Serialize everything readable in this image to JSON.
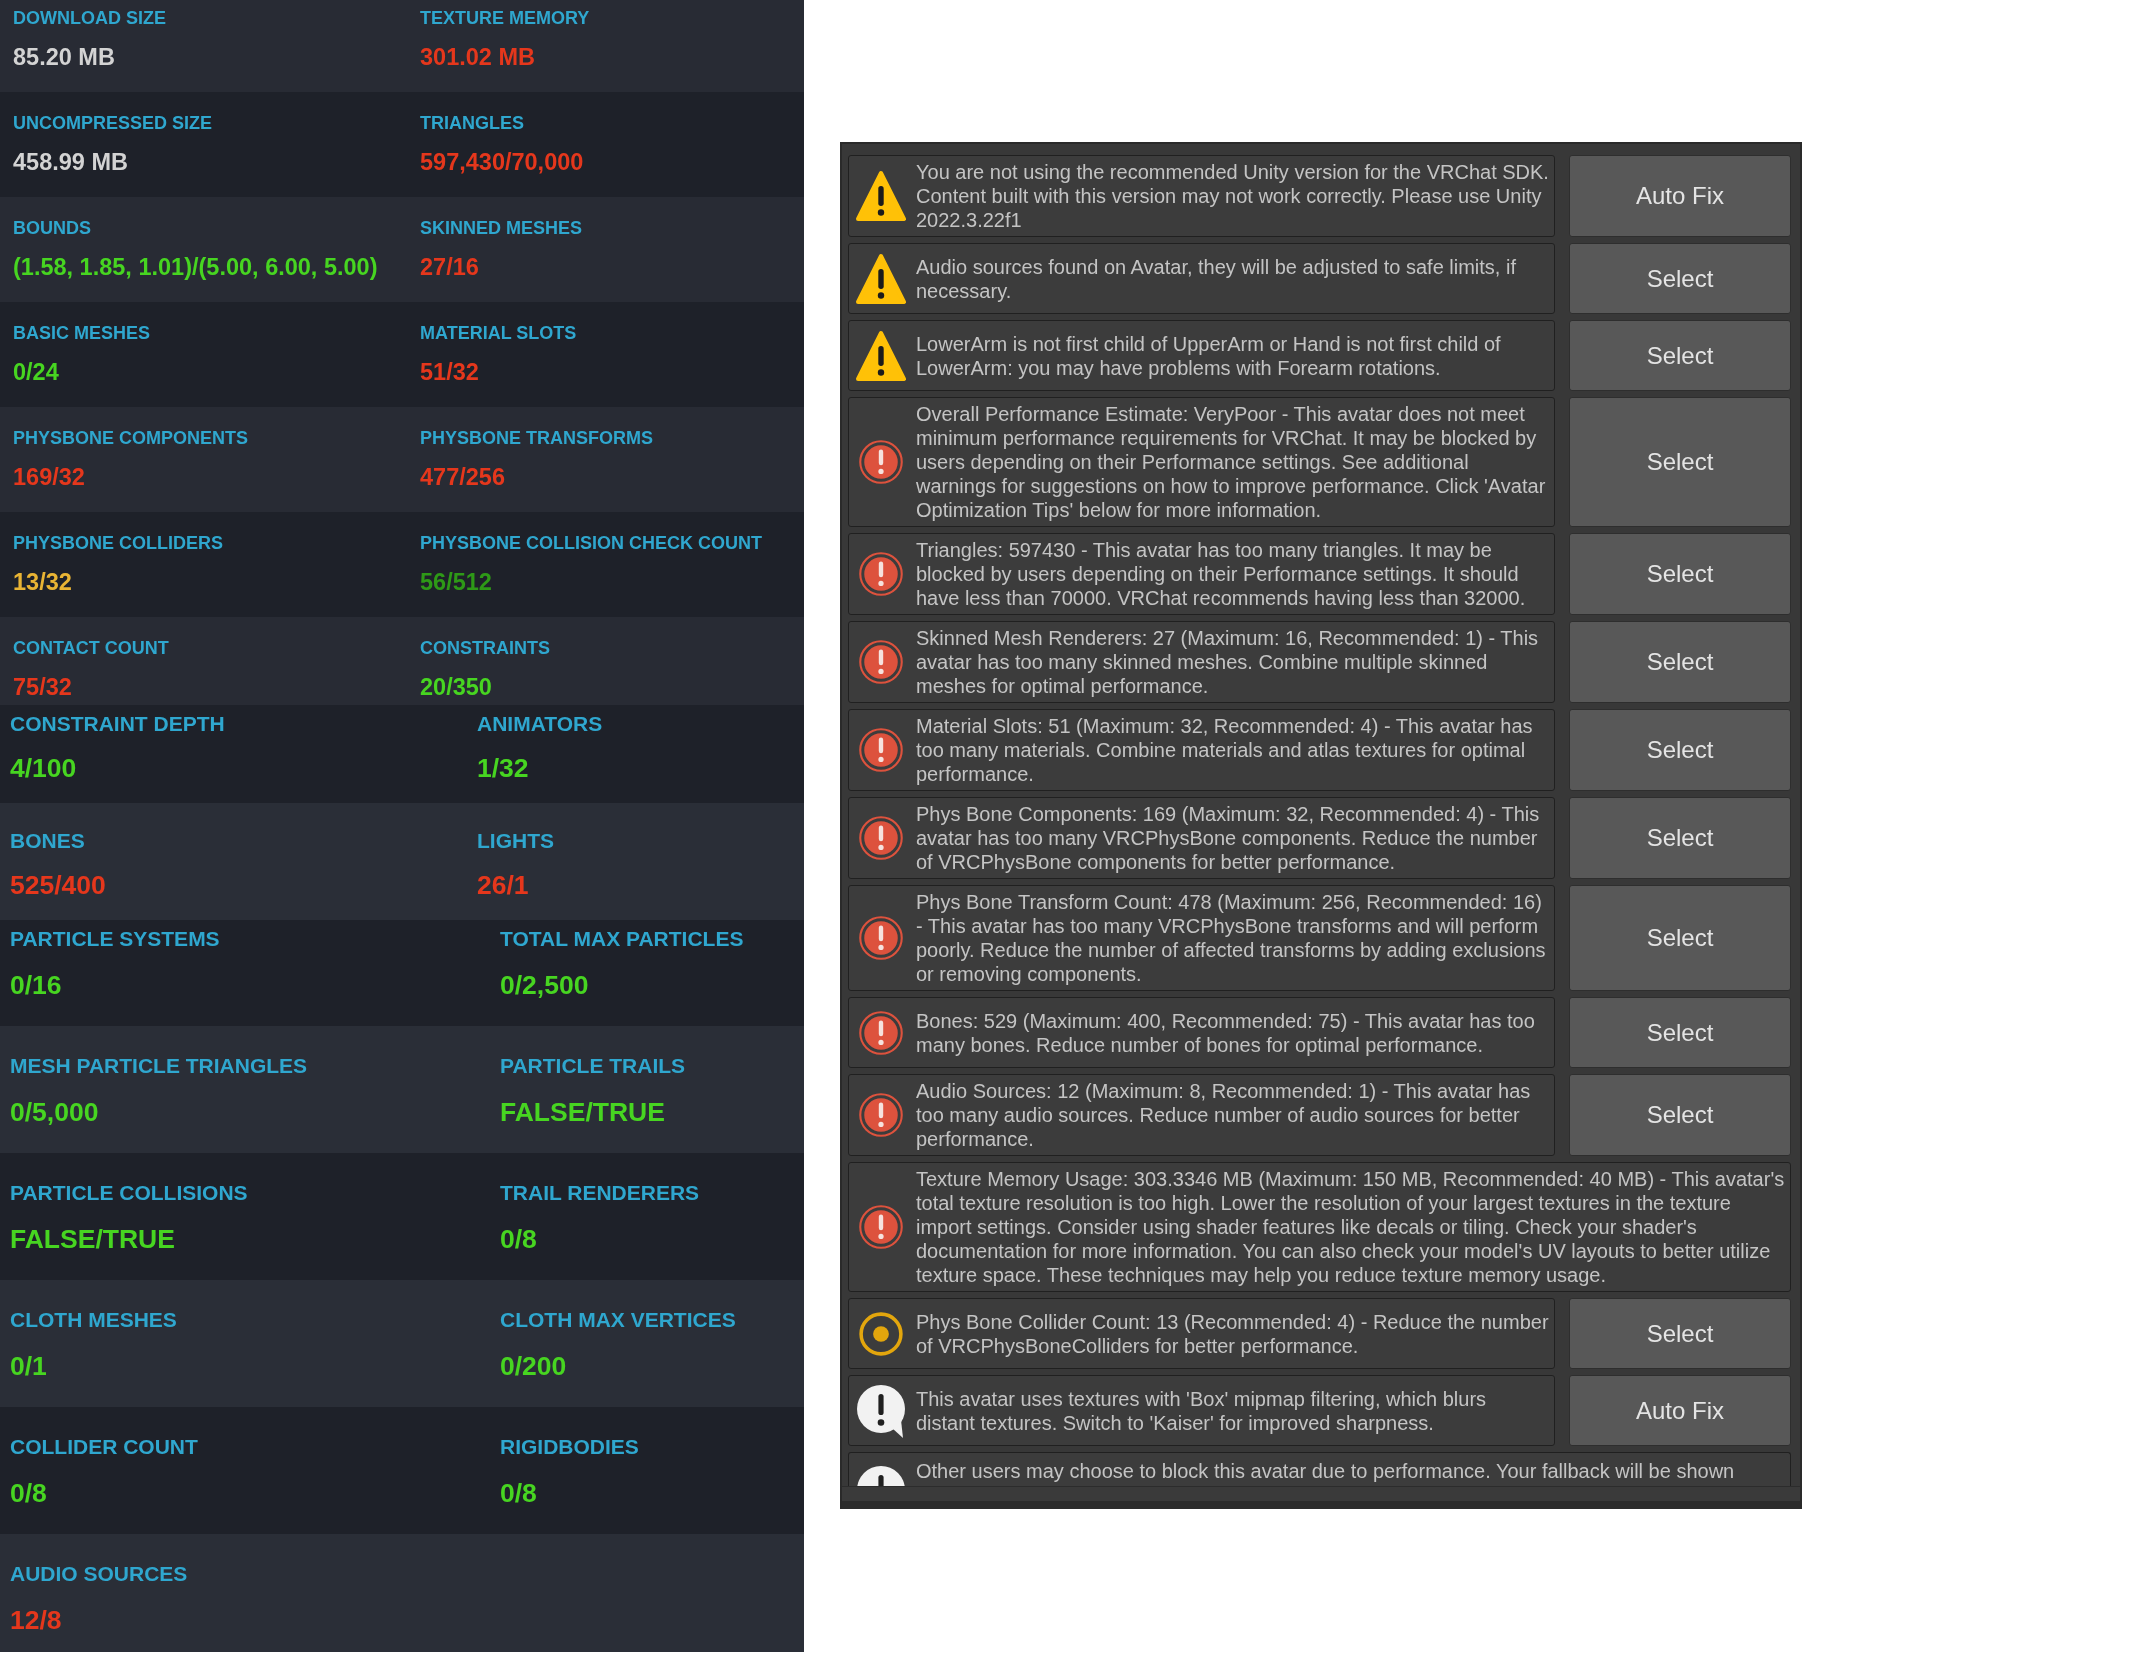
{
  "stats_panels": [
    {
      "rows": [
        {
          "stats": [
            {
              "label": "DOWNLOAD SIZE",
              "value": "85.20 MB",
              "color": "#d3d3d3"
            },
            {
              "label": "TEXTURE MEMORY",
              "value": "301.02 MB",
              "color": "#e5371c"
            }
          ]
        },
        {
          "stats": [
            {
              "label": "UNCOMPRESSED SIZE",
              "value": "458.99 MB",
              "color": "#d3d3d3"
            },
            {
              "label": "TRIANGLES",
              "value": "597,430/70,000",
              "color": "#e5371c"
            }
          ]
        },
        {
          "stats": [
            {
              "label": "BOUNDS",
              "value": "(1.58, 1.85, 1.01)/(5.00, 6.00, 5.00)",
              "color": "#47d521"
            },
            {
              "label": "SKINNED MESHES",
              "value": "27/16",
              "color": "#e5371c"
            }
          ]
        },
        {
          "stats": [
            {
              "label": "BASIC MESHES",
              "value": "0/24",
              "color": "#47d521"
            },
            {
              "label": "MATERIAL SLOTS",
              "value": "51/32",
              "color": "#e5371c"
            }
          ]
        },
        {
          "stats": [
            {
              "label": "PHYSBONE COMPONENTS",
              "value": "169/32",
              "color": "#e5371c"
            },
            {
              "label": "PHYSBONE TRANSFORMS",
              "value": "477/256",
              "color": "#e5371c"
            }
          ]
        },
        {
          "stats": [
            {
              "label": "PHYSBONE COLLIDERS",
              "value": "13/32",
              "color": "#e9b434"
            },
            {
              "label": "PHYSBONE COLLISION CHECK COUNT",
              "value": "56/512",
              "color": "#2e9917"
            }
          ]
        },
        {
          "stats": [
            {
              "label": "CONTACT COUNT",
              "value": "75/32",
              "color": "#e5371c"
            },
            {
              "label": "CONSTRAINTS",
              "value": "20/350",
              "color": "#47d521"
            }
          ]
        }
      ]
    },
    {
      "rows": [
        {
          "stats": [
            {
              "label": "CONSTRAINT DEPTH",
              "value": "4/100",
              "color": "#47d521"
            },
            {
              "label": "ANIMATORS",
              "value": "1/32",
              "color": "#47d521"
            }
          ]
        },
        {
          "stats": [
            {
              "label": "BONES",
              "value": "525/400",
              "color": "#e5371c"
            },
            {
              "label": "LIGHTS",
              "value": "26/1",
              "color": "#e5371c"
            }
          ]
        }
      ]
    },
    {
      "rows": [
        {
          "stats": [
            {
              "label": "PARTICLE SYSTEMS",
              "value": "0/16",
              "color": "#47d521"
            },
            {
              "label": "TOTAL MAX PARTICLES",
              "value": "0/2,500",
              "color": "#47d521"
            }
          ]
        },
        {
          "stats": [
            {
              "label": "MESH PARTICLE TRIANGLES",
              "value": "0/5,000",
              "color": "#47d521"
            },
            {
              "label": "PARTICLE TRAILS",
              "value": "FALSE/TRUE",
              "color": "#47d521"
            }
          ]
        },
        {
          "stats": [
            {
              "label": "PARTICLE COLLISIONS",
              "value": "FALSE/TRUE",
              "color": "#47d521"
            },
            {
              "label": "TRAIL RENDERERS",
              "value": "0/8",
              "color": "#47d521"
            }
          ]
        },
        {
          "stats": [
            {
              "label": "CLOTH MESHES",
              "value": "0/1",
              "color": "#47d521"
            },
            {
              "label": "CLOTH MAX VERTICES",
              "value": "0/200",
              "color": "#47d521"
            }
          ]
        },
        {
          "stats": [
            {
              "label": "COLLIDER COUNT",
              "value": "0/8",
              "color": "#47d521"
            },
            {
              "label": "RIGIDBODIES",
              "value": "0/8",
              "color": "#47d521"
            }
          ]
        },
        {
          "stats": [
            {
              "label": "AUDIO SOURCES",
              "value": "12/8",
              "color": "#e5371c"
            }
          ]
        }
      ]
    }
  ],
  "validation_messages": [
    {
      "kind": "warning",
      "text": "You are not using the recommended Unity version for the VRChat SDK. Content built with this version may not work correctly. Please use Unity 2022.3.22f1",
      "button": "Auto Fix"
    },
    {
      "kind": "warning",
      "text": "Audio sources found on Avatar, they will be adjusted to safe limits, if necessary.",
      "button": "Select"
    },
    {
      "kind": "warning",
      "text": "LowerArm is not first child of UpperArm or Hand is not first child of LowerArm: you may have problems with Forearm rotations.",
      "button": "Select"
    },
    {
      "kind": "error",
      "text": "Overall Performance Estimate: VeryPoor - This avatar does not meet minimum performance requirements for VRChat. It may be blocked by users depending on their Performance settings. See additional warnings for suggestions on how to improve performance. Click 'Avatar Optimization Tips' below for more information.",
      "button": "Select"
    },
    {
      "kind": "error",
      "text": "Triangles: 597430 - This avatar has too many triangles. It may be blocked by users depending on their Performance settings. It should have less than 70000. VRChat recommends having less than 32000.",
      "button": "Select"
    },
    {
      "kind": "error",
      "text": "Skinned Mesh Renderers: 27 (Maximum: 16, Recommended: 1) - This avatar has too many skinned meshes. Combine multiple skinned meshes for optimal performance.",
      "button": "Select"
    },
    {
      "kind": "error",
      "text": "Material Slots: 51 (Maximum: 32, Recommended: 4) - This avatar has too many materials. Combine materials and atlas textures for optimal performance.",
      "button": "Select"
    },
    {
      "kind": "error",
      "text": "Phys Bone Components: 169 (Maximum: 32, Recommended: 4) - This avatar has too many VRCPhysBone components. Reduce the number of VRCPhysBone components for better performance.",
      "button": "Select"
    },
    {
      "kind": "error",
      "text": "Phys Bone Transform Count: 478 (Maximum: 256, Recommended: 16) - This avatar has too many VRCPhysBone transforms and will perform poorly. Reduce the number of affected transforms by adding exclusions or removing components.",
      "button": "Select"
    },
    {
      "kind": "error",
      "text": "Bones: 529 (Maximum: 400, Recommended: 75) - This avatar has too many bones. Reduce number of bones for optimal performance.",
      "button": "Select"
    },
    {
      "kind": "error",
      "text": "Audio Sources: 12 (Maximum: 8, Recommended: 1) - This avatar has too many audio sources. Reduce number of audio sources for better performance.",
      "button": "Select"
    },
    {
      "kind": "error",
      "text": "Texture Memory Usage: 303.3346 MB (Maximum: 150 MB, Recommended: 40 MB) - This avatar's total texture resolution is too high. Lower the resolution of your largest textures in the texture import settings. Consider using shader features like decals or tiling. Check your shader's documentation for more information. You can also check your model's UV layouts to better utilize texture space. These techniques may help you reduce texture memory usage."
    },
    {
      "kind": "notice",
      "text": "Phys Bone Collider Count: 13 (Recommended: 4) - Reduce the number of VRCPhysBoneColliders for better performance.",
      "button": "Select"
    },
    {
      "kind": "info",
      "text": "This avatar uses textures with 'Box' mipmap filtering, which blurs distant textures. Switch to 'Kaiser' for improved sharpness.",
      "button": "Auto Fix"
    },
    {
      "kind": "info",
      "text": "Other users may choose to block this avatar due to performance. Your fallback will be shown"
    }
  ]
}
